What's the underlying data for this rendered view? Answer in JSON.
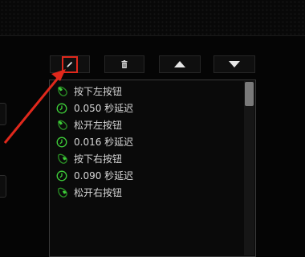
{
  "toolbar": {
    "edit_icon": "pencil-icon",
    "delete_icon": "trash-icon",
    "up_icon": "arrow-up-icon",
    "down_icon": "arrow-down-icon"
  },
  "macro_list": [
    {
      "icon": "mouse-left-icon",
      "text": "按下左按钮"
    },
    {
      "icon": "clock-icon",
      "text": "0.050 秒延迟"
    },
    {
      "icon": "mouse-left-icon",
      "text": "松开左按钮"
    },
    {
      "icon": "clock-icon",
      "text": "0.016 秒延迟"
    },
    {
      "icon": "mouse-right-icon",
      "text": "按下右按钮"
    },
    {
      "icon": "clock-icon",
      "text": "0.090 秒延迟"
    },
    {
      "icon": "mouse-right-icon",
      "text": "松开右按钮"
    }
  ],
  "colors": {
    "accent": "#3fd13a",
    "annotation": "#e0281c",
    "background": "#050505"
  }
}
